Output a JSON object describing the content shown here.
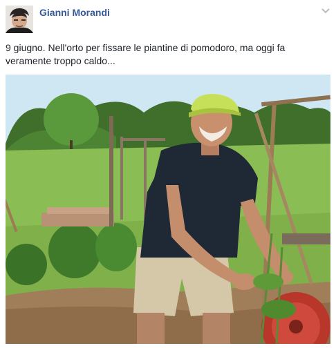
{
  "post": {
    "author": "Gianni Morandi",
    "timestamp": "",
    "caption": "9 giugno. Nell'orto per fissare le piantine di pomodoro, ma oggi fa veramente troppo caldo...",
    "menu_icon": "chevron-down-icon"
  },
  "photo": {
    "description_icon": "photo"
  }
}
